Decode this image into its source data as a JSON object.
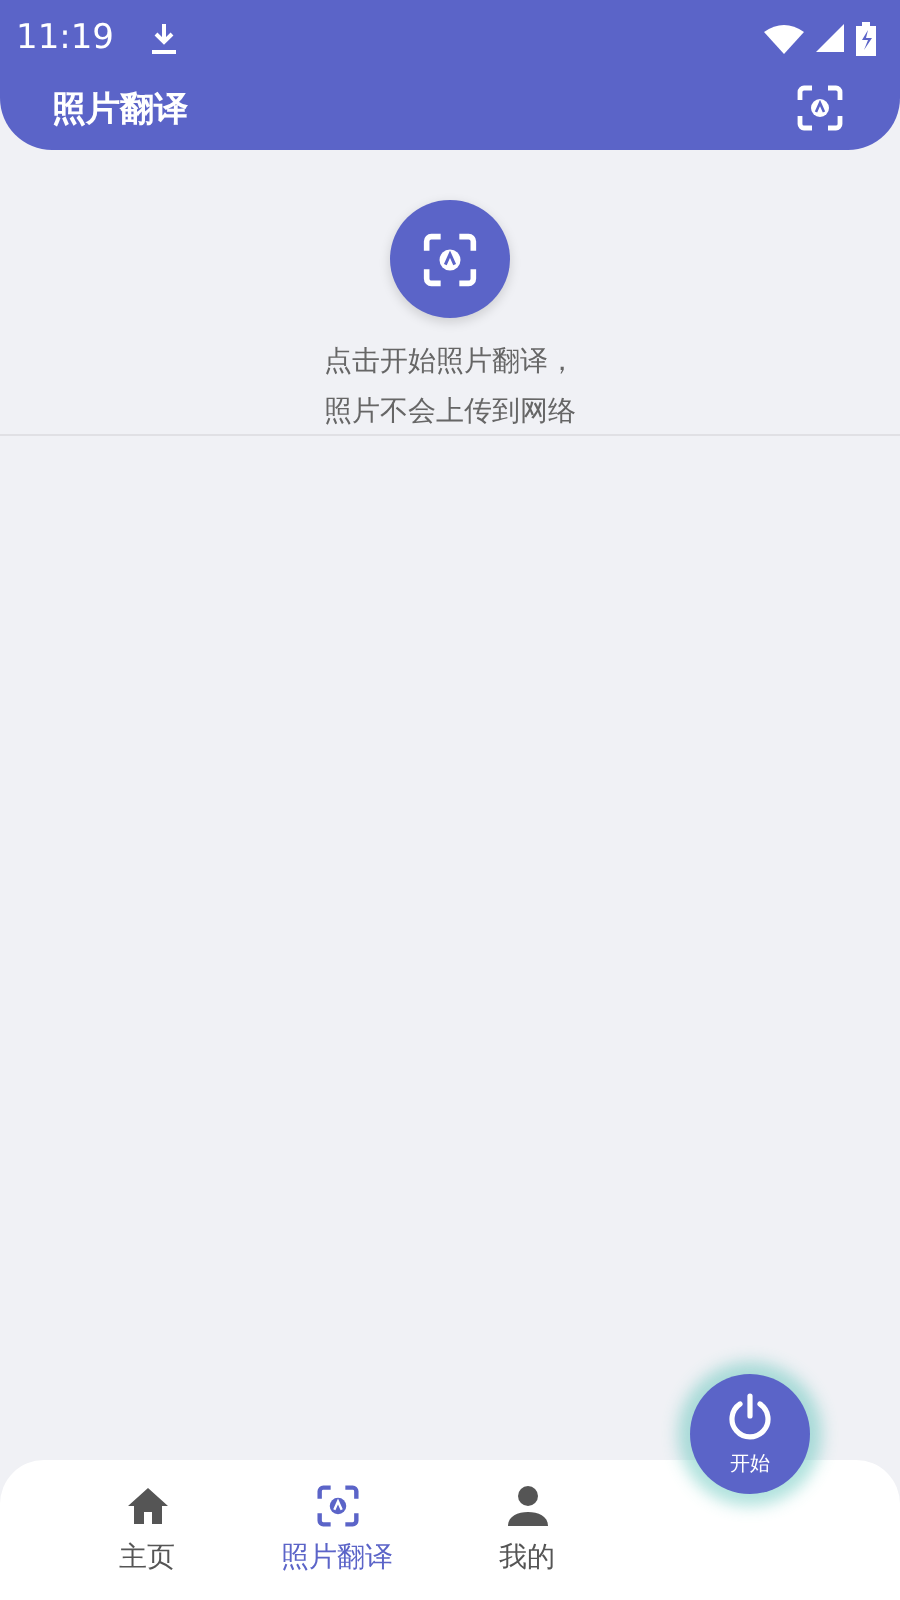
{
  "status_bar": {
    "time": "11:19"
  },
  "app_bar": {
    "title": "照片翻译"
  },
  "intro": {
    "lines": [
      "点击开始照片翻译，",
      "照片不会上传到网络"
    ]
  },
  "start_button": {
    "label": "开始"
  },
  "tabs": [
    {
      "kind": "home",
      "label": "主页",
      "selected": false
    },
    {
      "kind": "scan",
      "label": "照片翻译",
      "selected": true
    },
    {
      "kind": "person",
      "label": "我的",
      "selected": false
    }
  ]
}
